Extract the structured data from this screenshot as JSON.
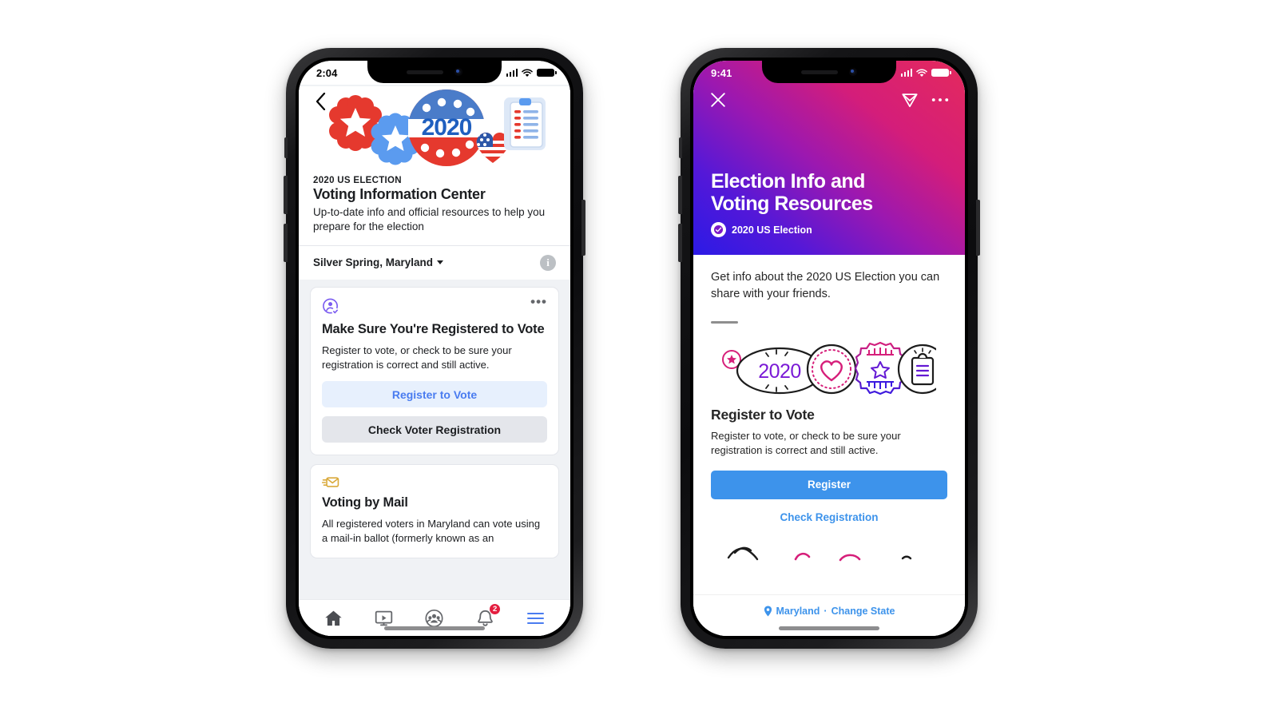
{
  "left_phone": {
    "status_bar": {
      "time": "2:04",
      "signal_icon": "cellular-bars-icon",
      "wifi_icon": "wifi-icon",
      "battery_icon": "battery-icon"
    },
    "back_icon": "back-chevron-icon",
    "hero_art_icon": "election-badges-illustration",
    "eyebrow": "2020 US ELECTION",
    "title": "Voting Information Center",
    "subtitle": "Up-to-date info and official resources to help you prepare for the election",
    "location": {
      "label": "Silver Spring, Maryland",
      "caret_icon": "chevron-down-icon",
      "info_icon": "info-circle-icon",
      "info_glyph": "i"
    },
    "cards": [
      {
        "icon": "registered-voter-icon",
        "menu_icon": "more-options-icon",
        "menu_glyph": "•••",
        "title": "Make Sure You're Registered to Vote",
        "description": "Register to vote, or check to be sure your registration is correct and still active.",
        "primary_button": "Register to Vote",
        "secondary_button": "Check Voter Registration"
      },
      {
        "icon": "mail-envelope-icon",
        "title": "Voting by Mail",
        "description": "All registered voters in Maryland can vote using a mail-in ballot (formerly known as an"
      }
    ],
    "tab_bar": [
      {
        "name": "home",
        "icon": "home-icon",
        "badge": ""
      },
      {
        "name": "watch",
        "icon": "watch-video-icon",
        "badge": ""
      },
      {
        "name": "groups",
        "icon": "groups-icon",
        "badge": ""
      },
      {
        "name": "notifications",
        "icon": "bell-icon",
        "badge": "2"
      },
      {
        "name": "menu",
        "icon": "hamburger-menu-icon",
        "badge": ""
      }
    ]
  },
  "right_phone": {
    "status_bar": {
      "time": "9:41",
      "signal_icon": "cellular-bars-icon",
      "wifi_icon": "wifi-icon",
      "battery_icon": "battery-icon"
    },
    "close_icon": "close-x-icon",
    "share_icon": "paper-plane-icon",
    "more_icon": "more-options-icon",
    "more_glyph": "•••",
    "title_line1": "Election Info and",
    "title_line2": "Voting Resources",
    "badge_icon": "verified-check-badge-icon",
    "meta_label": "2020 US Election",
    "lead": "Get info about the 2020 US Election you can share with your friends.",
    "art_icon": "election-sticker-outline-illustration",
    "section_title": "Register to Vote",
    "section_desc": "Register to vote, or check to be sure your registration is correct and still active.",
    "primary_button": "Register",
    "secondary_link": "Check Registration",
    "footer": {
      "pin_icon": "location-pin-icon",
      "state": "Maryland",
      "separator": "·",
      "change_link": "Change State"
    }
  },
  "colors": {
    "fb_blue": "#4a7cf0",
    "fb_button_bg": "#e7f0fd",
    "fb_secondary_bg": "#e4e6eb",
    "ig_blue": "#3d93eb",
    "ig_gradient_start": "#2b1ae6",
    "ig_gradient_end": "#e42a5c",
    "badge_red": "#e41e3f",
    "purple_icon": "#7a5bf0",
    "gold_icon": "#d9a93a"
  }
}
